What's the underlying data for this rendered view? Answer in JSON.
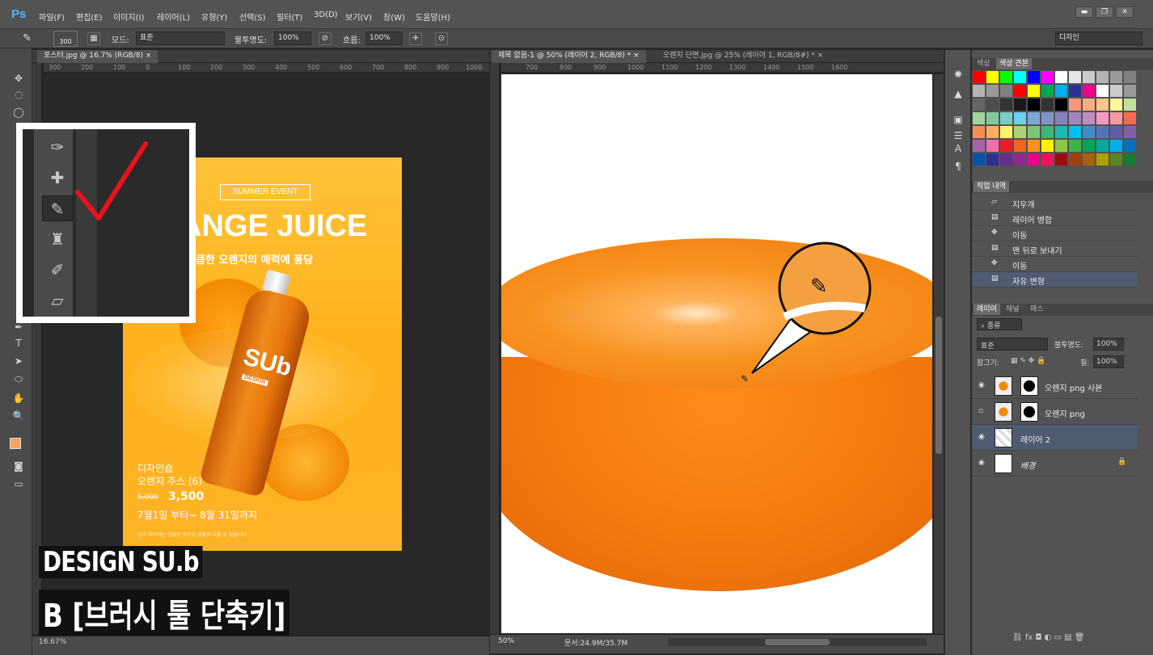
{
  "app": {
    "logo": "Ps"
  },
  "menu": [
    "파일(F)",
    "편집(E)",
    "이미지(I)",
    "레이어(L)",
    "유형(Y)",
    "선택(S)",
    "필터(T)",
    "3D(D)",
    "보기(V)",
    "창(W)",
    "도움말(H)"
  ],
  "window_controls": {
    "minimize": "▬",
    "restore": "❐",
    "close": "✕"
  },
  "options": {
    "brush_size": "300",
    "mode_label": "모드:",
    "mode_value": "표준",
    "opacity_label": "불투명도:",
    "opacity_value": "100%",
    "flow_label": "흐름:",
    "flow_value": "100%",
    "workspace": "디자인"
  },
  "tabs_left": [
    {
      "label": "포스터.jpg @ 16.7% (RGB/8)",
      "close": "×"
    }
  ],
  "tabs_right": [
    {
      "label": "제목 없음-1 @ 50% (레이어 2, RGB/8) *",
      "close": "×"
    },
    {
      "label": "오렌지 단면.jpg @ 25% (레이어 1, RGB/8#) *",
      "close": "×"
    }
  ],
  "ruler_left": [
    "300",
    "200",
    "100",
    "0",
    "100",
    "200",
    "300",
    "400",
    "500",
    "600",
    "700",
    "800",
    "900",
    "1000"
  ],
  "ruler_right": [
    "700",
    "800",
    "900",
    "1000",
    "1100",
    "1200",
    "1300",
    "1400",
    "1500",
    "1600"
  ],
  "poster": {
    "event": "SUMMER EVENT",
    "title": "ANGE JUICE",
    "subtitle": "상큼한 오렌지의 매력에 퐁당",
    "bottle_logo": "SUb",
    "bottle_sub": "DESIGN",
    "line1": "디자인숍",
    "line2": "오렌지 주스 (6)",
    "old_price": "5,000",
    "price": "3,500",
    "date": "7월1일 부터~ 8월 31일까지",
    "fine_print": "상기 이미지는 연출된 것으로 실물과 다를 수 있습니다"
  },
  "overlay": {
    "brand": "DESIGN SU.b",
    "caption": "B [브러시 툴 단축키]"
  },
  "status_left": {
    "zoom": "16.67%"
  },
  "status_right": {
    "zoom": "50%",
    "doc": "문서:24.9M/35.7M"
  },
  "swatches_panel": {
    "tabs": [
      "색상",
      "색상 견본"
    ]
  },
  "swatch_colors": [
    [
      "#ff0000",
      "#ffff00",
      "#00ff00",
      "#00ffff",
      "#0000ff",
      "#ff00ff",
      "#ffffff",
      "#e6e6e6",
      "#cccccc",
      "#b3b3b3",
      "#999999",
      "#808080"
    ],
    [
      "#b3b3b3",
      "#999999",
      "#808080",
      "#ff0000",
      "#ffff00",
      "#00a651",
      "#00aeef",
      "#2e3192",
      "#ec008c",
      "#ffffff",
      "#cccccc",
      "#999999"
    ],
    [
      "#666666",
      "#4d4d4d",
      "#333333",
      "#1a1a1a",
      "#000000",
      "#333333",
      "#000000",
      "#f7977a",
      "#f9ad81",
      "#fdc68a",
      "#fff79a",
      "#c4df9b"
    ],
    [
      "#a3d39c",
      "#82ca9d",
      "#7accc8",
      "#6dcff6",
      "#7da7d9",
      "#8393ca",
      "#8781bd",
      "#a187be",
      "#bc8dbf",
      "#f49ac2",
      "#f6989d",
      "#f26c4f"
    ],
    [
      "#f68e55",
      "#fbaf5d",
      "#fff467",
      "#acd372",
      "#7cc576",
      "#3bb878",
      "#1abbb4",
      "#00bff3",
      "#438ccb",
      "#5574b9",
      "#605ca8",
      "#855fa8"
    ],
    [
      "#a763a8",
      "#f06ea9",
      "#ed1c24",
      "#f26522",
      "#f7941d",
      "#fff200",
      "#8dc73f",
      "#39b54a",
      "#00a651",
      "#00a99d",
      "#00aeef",
      "#0072bc"
    ],
    [
      "#0054a6",
      "#2e3192",
      "#662d91",
      "#92278f",
      "#ec008c",
      "#ed145b",
      "#9e0b0f",
      "#a0410d",
      "#a36209",
      "#aba000",
      "#598527",
      "#197b30"
    ]
  ],
  "history": {
    "tab": "작업 내역",
    "items": [
      "지우개",
      "레이어 병합",
      "이동",
      "맨 뒤로 보내기",
      "이동",
      "자유 변형"
    ]
  },
  "layers": {
    "tabs": [
      "레이어",
      "채널",
      "패스"
    ],
    "filter": "종류",
    "blend": "표준",
    "opacity_label": "불투명도:",
    "opacity": "100%",
    "lock_label": "잠그기:",
    "fill_label": "칠:",
    "fill": "100%",
    "items": [
      "오렌지 png 사본",
      "오렌지 png",
      "레이어 2",
      "배경"
    ]
  },
  "colors": {
    "accent": "#4ab3ff",
    "selected_row": "#4f5b70",
    "foreground": "#f4a460",
    "checkmark": "#e8121c"
  }
}
